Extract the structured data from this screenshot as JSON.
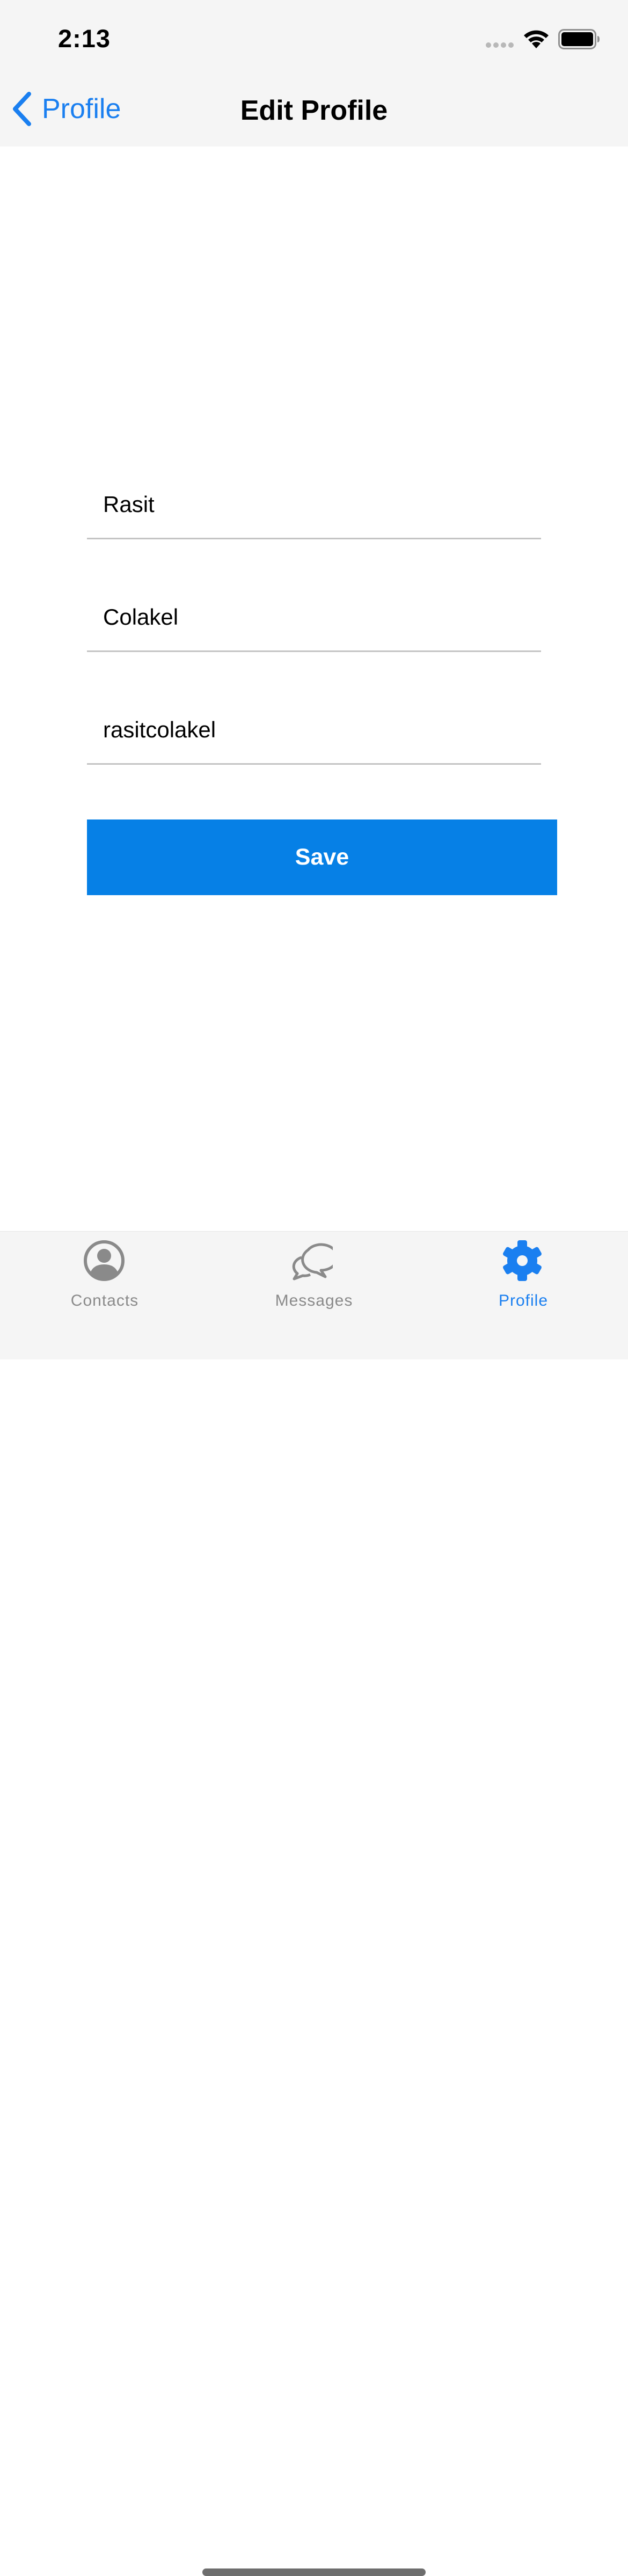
{
  "status_bar": {
    "time": "2:13"
  },
  "nav": {
    "back_label": "Profile",
    "title": "Edit Profile"
  },
  "form": {
    "first_name": "Rasit",
    "last_name": "Colakel",
    "username": "rasitcolakel",
    "save_label": "Save"
  },
  "tabs": [
    {
      "label": "Contacts",
      "icon": "contacts-icon",
      "active": false
    },
    {
      "label": "Messages",
      "icon": "messages-icon",
      "active": false
    },
    {
      "label": "Profile",
      "icon": "gear-icon",
      "active": true
    }
  ],
  "colors": {
    "accent": "#1a7ff0",
    "button": "#0680e6",
    "bar_background": "#f5f5f5",
    "inactive_tab": "#8a8a8a"
  }
}
